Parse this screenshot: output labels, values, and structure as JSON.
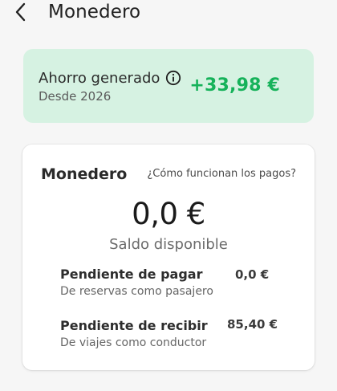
{
  "header": {
    "title": "Monedero",
    "back_icon": "chevron-left-icon"
  },
  "savings": {
    "title": "Ahorro generado",
    "since": "Desde 2026",
    "amount": "+33,98 €",
    "info_icon": "info-icon",
    "background_color": "#d6f2e2",
    "amount_color": "#16b25a"
  },
  "wallet": {
    "title": "Monedero",
    "how_link": "¿Cómo funcionan los pagos?",
    "balance": "0,0 €",
    "balance_label": "Saldo disponible",
    "pending_pay": {
      "title": "Pendiente de pagar",
      "subtitle": "De reservas como pasajero",
      "amount": "0,0 €"
    },
    "pending_receive": {
      "title": "Pendiente de recibir",
      "subtitle": "De viajes como conductor",
      "amount": "85,40 €"
    }
  }
}
